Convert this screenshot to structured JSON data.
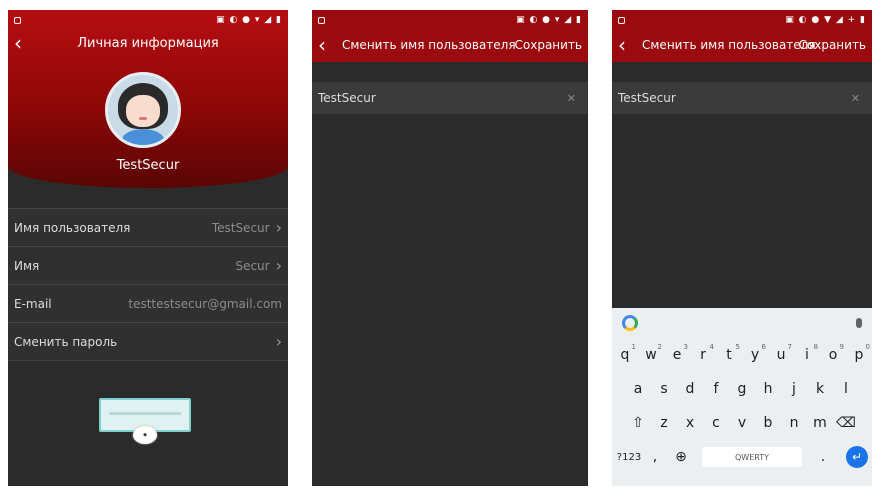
{
  "phone1": {
    "title": "Личная информация",
    "back_icon": "‹",
    "username": "TestSecur",
    "rows": [
      {
        "label": "Имя пользователя",
        "value": "TestSecur",
        "chevron": "›"
      },
      {
        "label": "Имя",
        "value": "Secur",
        "chevron": "›"
      },
      {
        "label": "E-mail",
        "value": "testtestsecur@gmail.com",
        "chevron": ""
      },
      {
        "label": "Сменить пароль",
        "value": "",
        "chevron": "›"
      }
    ]
  },
  "phone2": {
    "title": "Сменить имя пользователя",
    "save": "Сохранить",
    "field_value": "TestSecur",
    "clear_icon": "✕"
  },
  "phone3": {
    "title": "Сменить имя пользователя",
    "save": "Сохранить",
    "field_value": "TestSecur",
    "keyboard": {
      "row1": [
        "q",
        "w",
        "e",
        "r",
        "t",
        "y",
        "u",
        "i",
        "o",
        "p"
      ],
      "row1_nums": [
        "1",
        "2",
        "3",
        "4",
        "5",
        "6",
        "7",
        "8",
        "9",
        "0"
      ],
      "row2": [
        "a",
        "s",
        "d",
        "f",
        "g",
        "h",
        "j",
        "k",
        "l"
      ],
      "row3": [
        "z",
        "x",
        "c",
        "v",
        "b",
        "n",
        "m"
      ],
      "symbols_key": "?123",
      "comma_key": ",",
      "space_label": "QWERTY",
      "period_key": "."
    }
  }
}
